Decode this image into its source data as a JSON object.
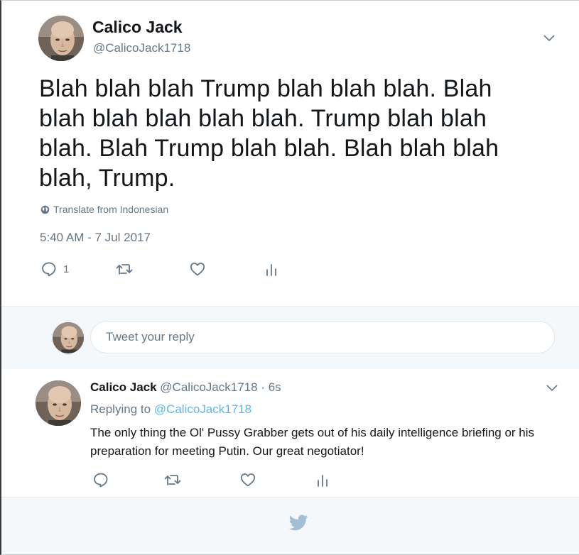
{
  "tweet": {
    "author_name": "Calico Jack",
    "author_handle": "@CalicoJack1718",
    "text": "Blah blah blah Trump blah blah blah. Blah blah blah blah blah blah. Trump blah blah blah. Blah Trump blah blah. Blah blah blah blah, Trump.",
    "translate_label": "Translate from Indonesian",
    "timestamp": "5:40 AM - 7 Jul 2017",
    "reply_count": "1",
    "icons": [
      "reply-icon",
      "retweet-icon",
      "like-icon",
      "analytics-icon",
      "chevron-down-icon",
      "globe-icon"
    ]
  },
  "reply_box": {
    "placeholder": "Tweet your reply"
  },
  "reply": {
    "author_name": "Calico Jack",
    "author_handle": "@CalicoJack1718",
    "separator": "·",
    "time": "6s",
    "replying_prefix": "Replying to",
    "replying_to": "@CalicoJack1718",
    "text": "The only thing the Ol' Pussy Grabber gets out of his daily intelligence briefing or his preparation for meeting Putin. Our great negotiator!"
  },
  "colors": {
    "text": "#14171a",
    "secondary": "#657786",
    "mention": "#58b7f2",
    "panel_bg": "#f5f8fa",
    "border": "#e6ecf0"
  }
}
